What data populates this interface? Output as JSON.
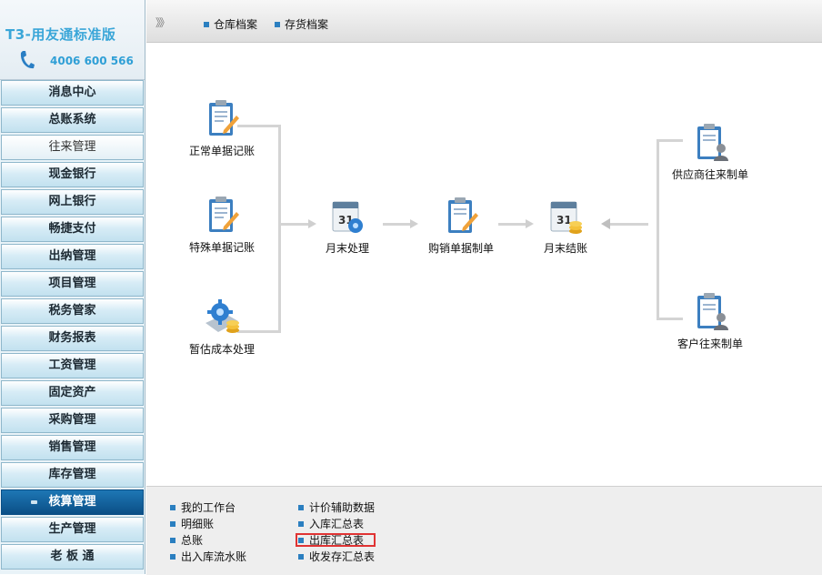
{
  "brand": {
    "title": "T3-用友通标准版",
    "phone": "4006 600 566"
  },
  "sidebar": {
    "items": [
      {
        "label": "消息中心"
      },
      {
        "label": "总账系统"
      },
      {
        "label": "往来管理"
      },
      {
        "label": "现金银行"
      },
      {
        "label": "网上银行"
      },
      {
        "label": "畅捷支付"
      },
      {
        "label": "出纳管理"
      },
      {
        "label": "项目管理"
      },
      {
        "label": "税务管家"
      },
      {
        "label": "财务报表"
      },
      {
        "label": "工资管理"
      },
      {
        "label": "固定资产"
      },
      {
        "label": "采购管理"
      },
      {
        "label": "销售管理"
      },
      {
        "label": "库存管理"
      },
      {
        "label": "核算管理"
      },
      {
        "label": "生产管理"
      },
      {
        "label": "老 板 通"
      }
    ],
    "active_label": "核算管理"
  },
  "header": {
    "arrows": "》》",
    "links": [
      "仓库档案",
      "存货档案"
    ]
  },
  "flow": {
    "normal_posting": "正常单据记账",
    "special_posting": "特殊单据记账",
    "estimated_cost": "暂估成本处理",
    "month_end": "月末处理",
    "purchase_sales_voucher": "购销单据制单",
    "month_close": "月末结账",
    "supplier_voucher": "供应商往来制单",
    "customer_voucher": "客户往来制单"
  },
  "bottom_links": {
    "col1": [
      "我的工作台",
      "明细账",
      "总账",
      "出入库流水账"
    ],
    "col2": [
      "计价辅助数据",
      "入库汇总表",
      "出库汇总表",
      "收发存汇总表"
    ]
  },
  "colors": {
    "accent": "#2b7fc0",
    "active_nav": "#0b4f86",
    "highlight": "#e03333",
    "connector": "#d4d4d4"
  }
}
